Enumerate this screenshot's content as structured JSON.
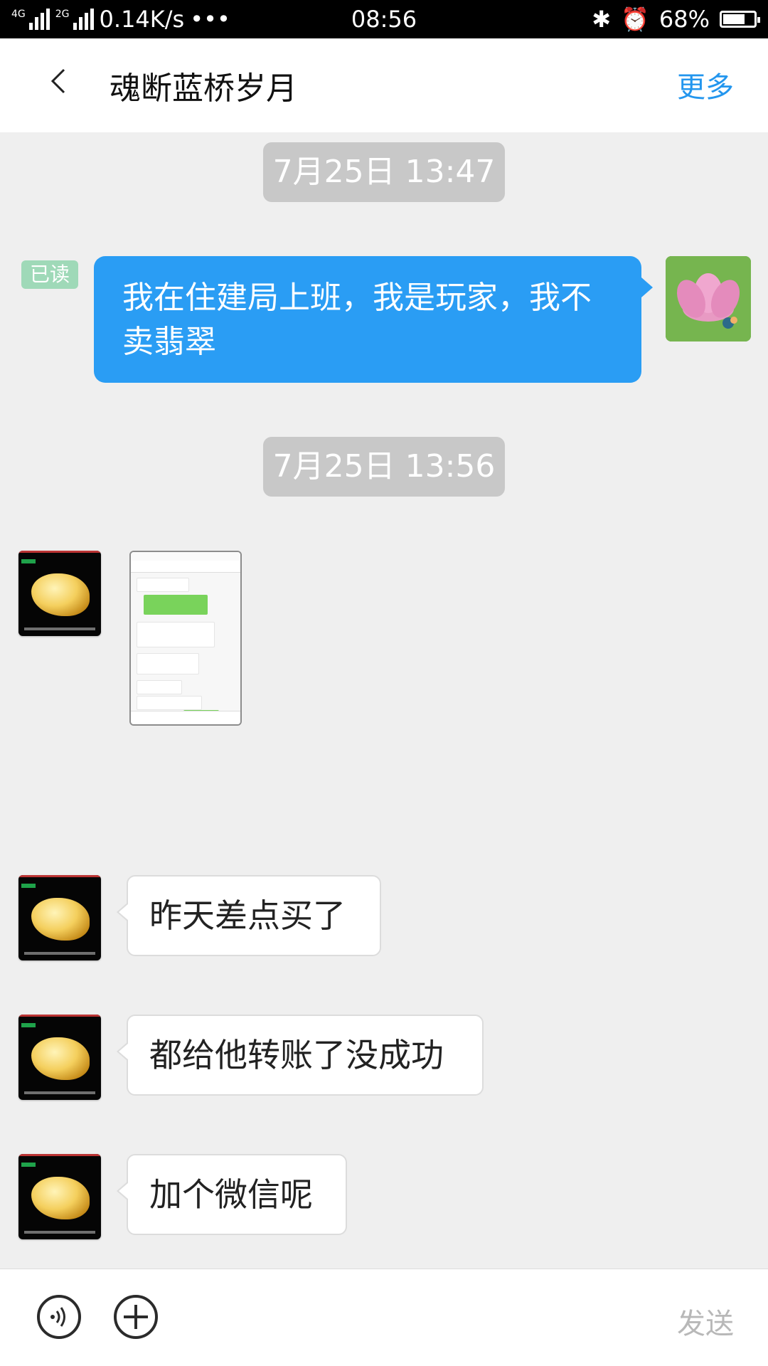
{
  "status_bar": {
    "network": "4G 4G 2G",
    "speed": "0.14K/s",
    "time": "08:56",
    "battery": "68%"
  },
  "header": {
    "title": "魂断蓝桥岁月",
    "more": "更多"
  },
  "messages": [
    {
      "type": "time",
      "text": "7月25日 13:47"
    },
    {
      "type": "outgoing",
      "text": "我在住建局上班，我是玩家，我不卖翡翠",
      "read_status": "已读"
    },
    {
      "type": "time",
      "text": "7月25日 13:56"
    },
    {
      "type": "image",
      "name": "chat-screenshot"
    },
    {
      "type": "incoming",
      "text": "昨天差点买了"
    },
    {
      "type": "incoming",
      "text": "都给他转账了没成功"
    },
    {
      "type": "incoming",
      "text": "加个微信呢"
    }
  ],
  "input": {
    "send_label": "发送"
  }
}
